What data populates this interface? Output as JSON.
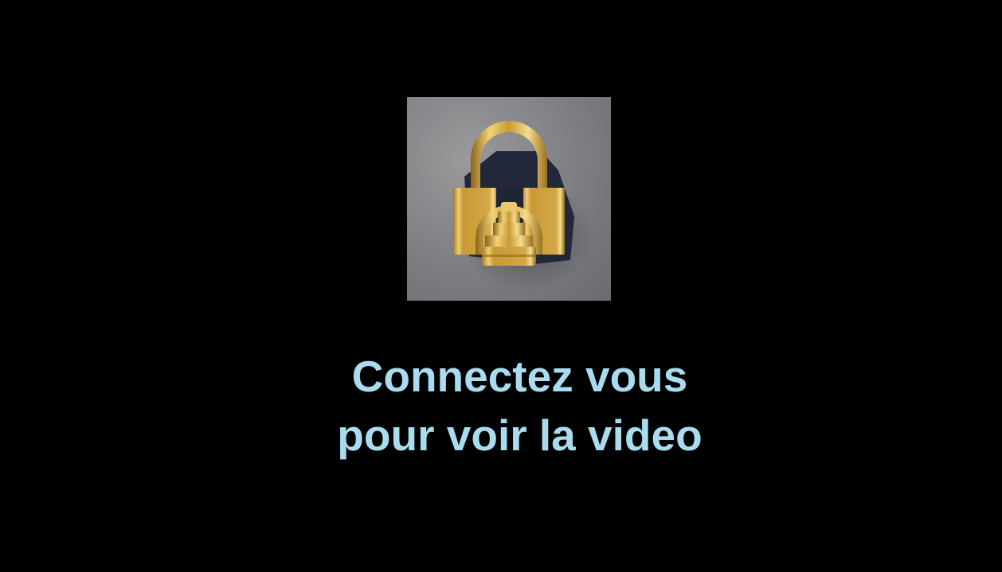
{
  "lock_image": {
    "icon": "padlock-icon",
    "background_color": "#808185",
    "gold_color": "#d4a73a"
  },
  "message": {
    "line1": "Connectez vous",
    "line2": "pour voir la video",
    "color": "#a8dcee"
  },
  "page": {
    "background_color": "#000000"
  }
}
